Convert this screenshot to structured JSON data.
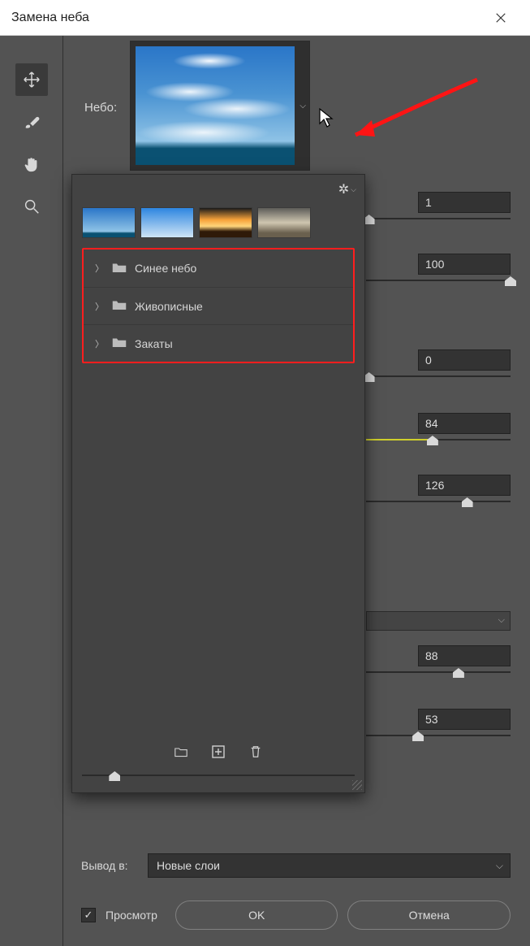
{
  "title": "Замена неба",
  "sky_label": "Небо:",
  "params": {
    "val1": {
      "value": "1",
      "pos": 2
    },
    "val2": {
      "value": "100",
      "pos": 100
    },
    "val3": {
      "value": "0",
      "pos": 2
    },
    "val4": {
      "value": "84",
      "pos": 46,
      "yellow": true
    },
    "val5": {
      "value": "126",
      "pos": 70
    },
    "val6": {
      "value": "88",
      "pos": 64
    },
    "val7": {
      "value": "53",
      "pos": 36
    }
  },
  "popover": {
    "folders": [
      "Синее небо",
      "Живописные",
      "Закаты"
    ]
  },
  "output": {
    "label": "Вывод в:",
    "value": "Новые слои"
  },
  "preview_label": "Просмотр",
  "ok_label": "OK",
  "cancel_label": "Отмена"
}
